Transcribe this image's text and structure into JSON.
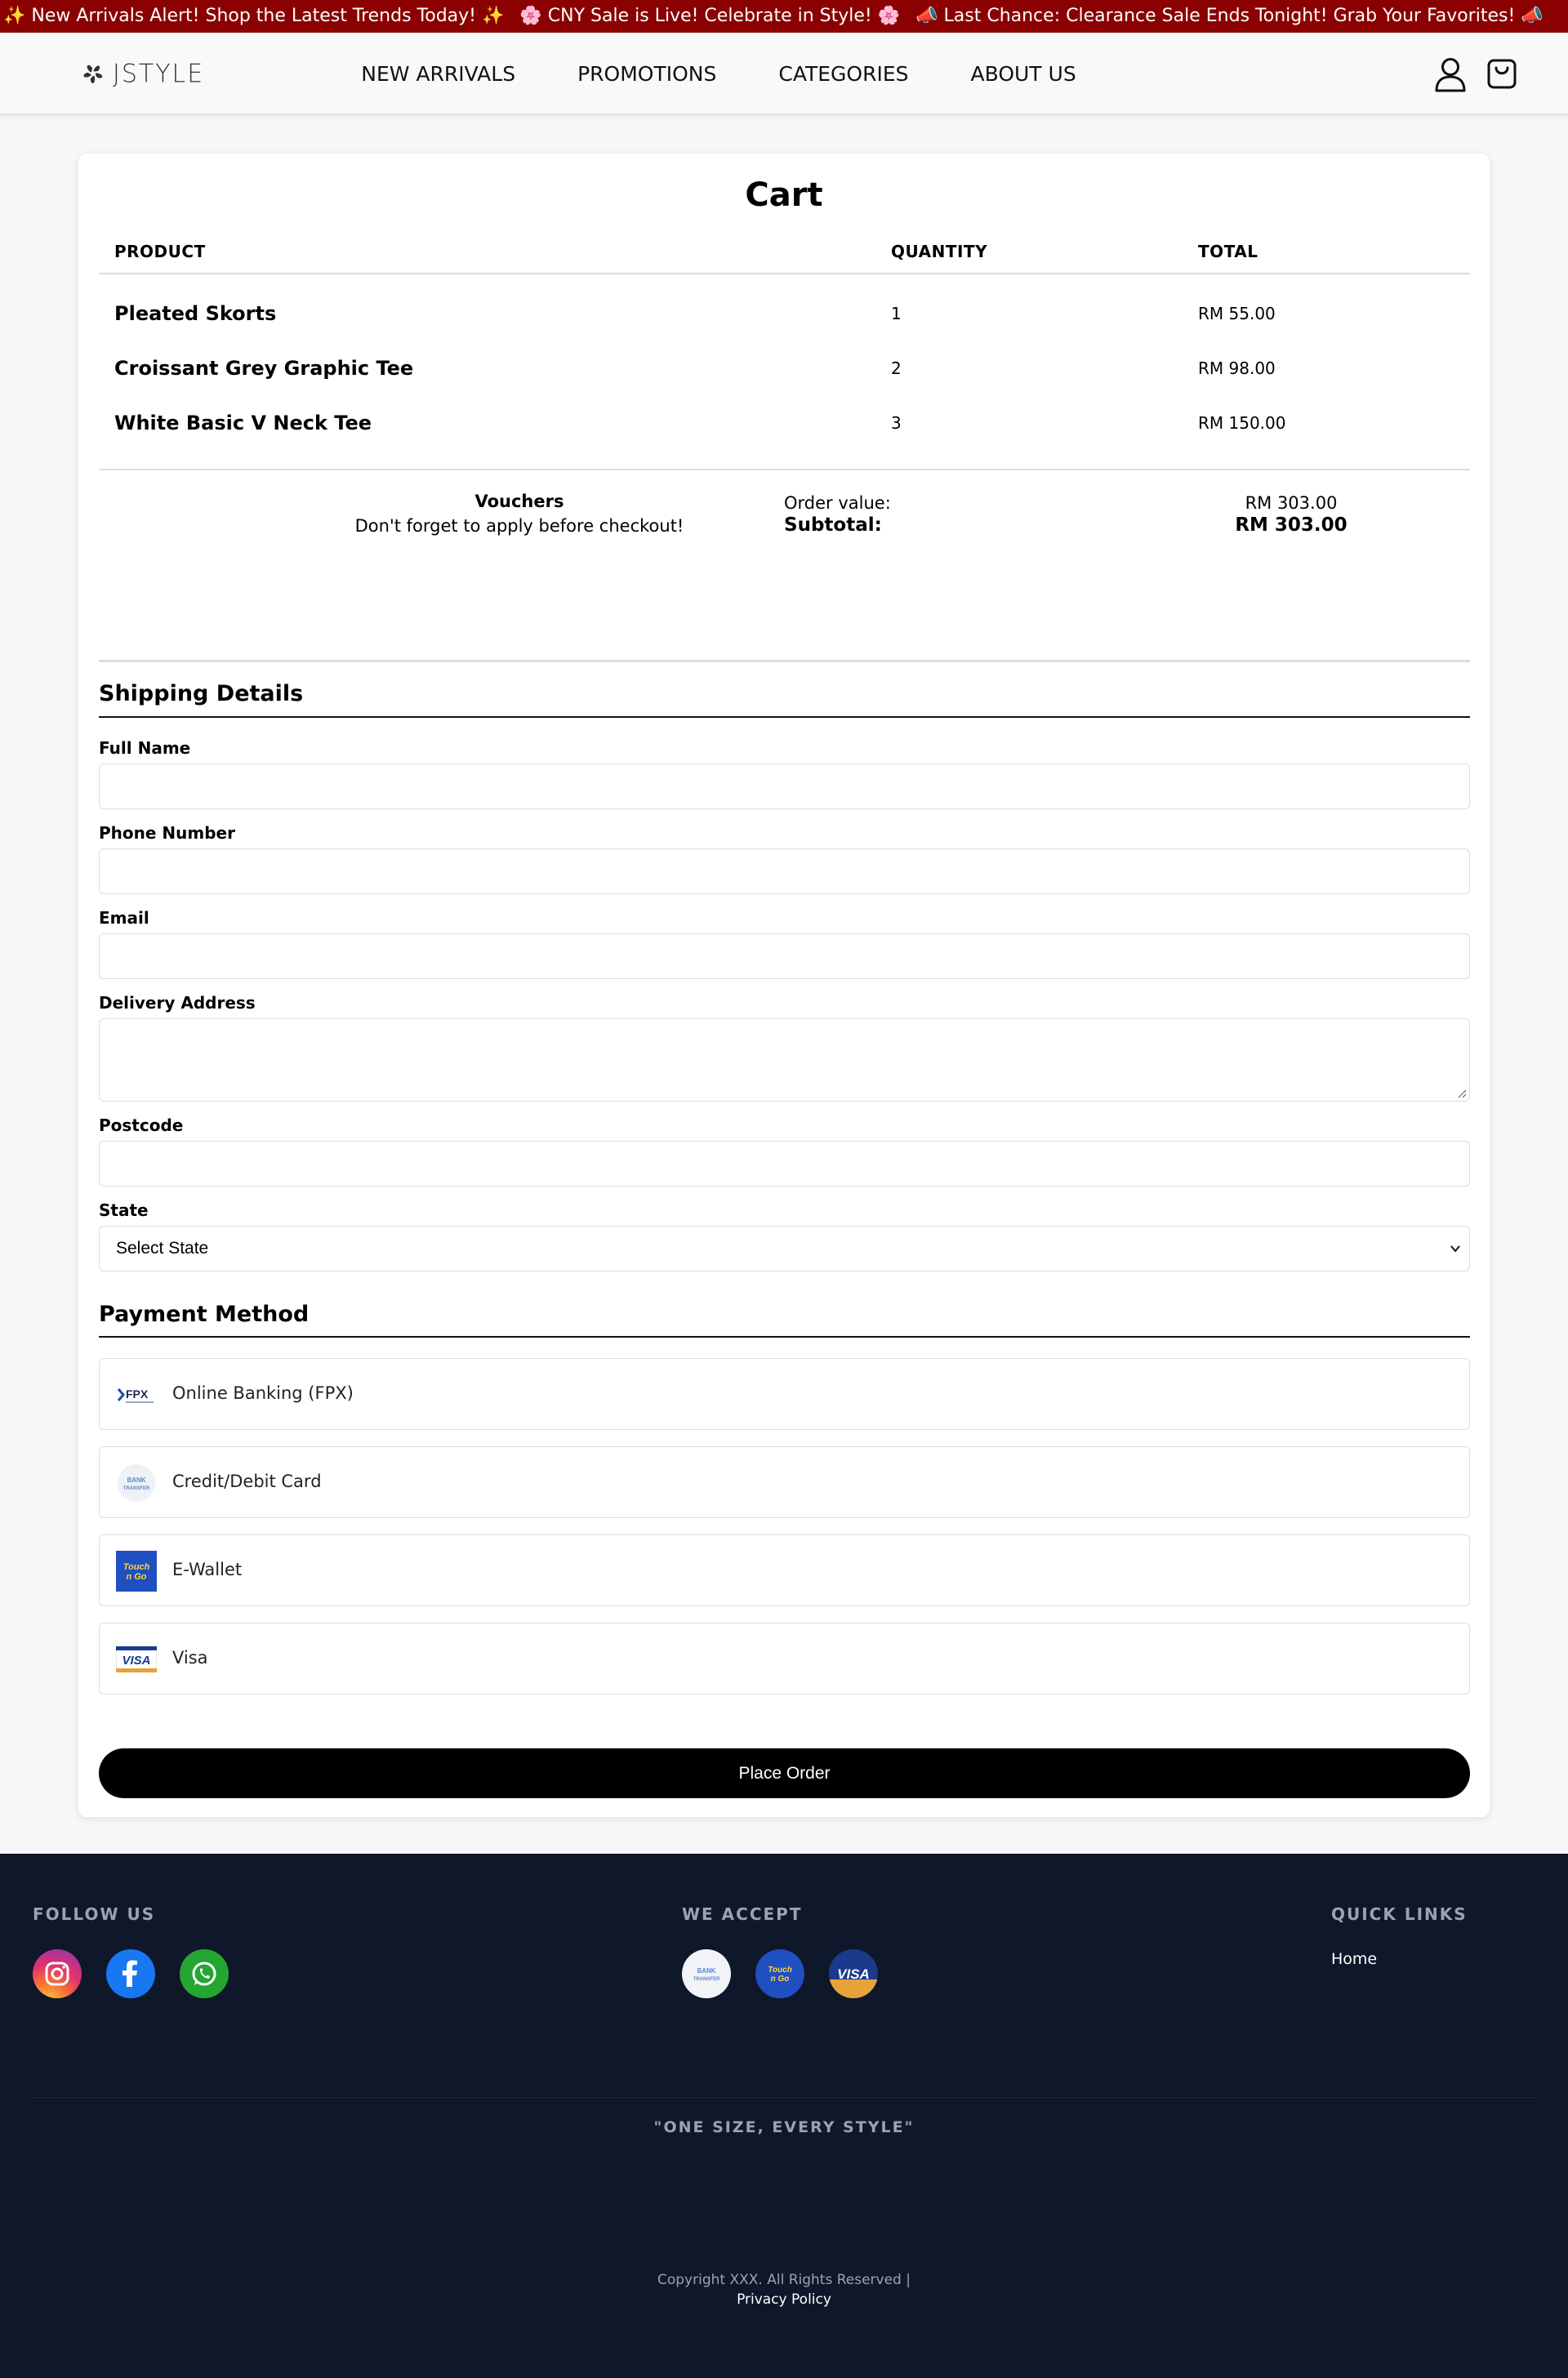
{
  "announcement": {
    "messages": [
      "✨ New Arrivals Alert! Shop the Latest Trends Today! ✨",
      "🌸 CNY Sale is Live! Celebrate in Style! 🌸",
      "📣 Last Chance: Clearance Sale Ends Tonight! Grab Your Favorites! 📣"
    ],
    "bg_color": "#8b0000"
  },
  "header": {
    "logo_text": "JSTYLE",
    "nav": [
      "NEW ARRIVALS",
      "PROMOTIONS",
      "CATEGORIES",
      "ABOUT US"
    ],
    "icons": [
      "user-icon",
      "shopping-bag-icon"
    ]
  },
  "cart": {
    "title": "Cart",
    "columns": [
      "PRODUCT",
      "QUANTITY",
      "TOTAL"
    ],
    "items": [
      {
        "name": "Pleated Skorts",
        "quantity": "1",
        "total": "RM 55.00"
      },
      {
        "name": "Croissant Grey Graphic Tee",
        "quantity": "2",
        "total": "RM 98.00"
      },
      {
        "name": "White Basic V Neck Tee",
        "quantity": "3",
        "total": "RM 150.00"
      }
    ],
    "vouchers_title": "Vouchers",
    "vouchers_note": "Don't forget to apply before checkout!",
    "order_value_label": "Order value:",
    "order_value": "RM 303.00",
    "subtotal_label": "Subtotal:",
    "subtotal": "RM 303.00"
  },
  "shipping": {
    "title": "Shipping Details",
    "full_name_label": "Full Name",
    "full_name_value": "",
    "phone_label": "Phone Number",
    "phone_value": "",
    "email_label": "Email",
    "email_value": "",
    "address_label": "Delivery Address",
    "address_value": "",
    "postcode_label": "Postcode",
    "postcode_value": "",
    "state_label": "State",
    "state_selected": "Select State"
  },
  "payment": {
    "title": "Payment Method",
    "methods": [
      {
        "label": "Online Banking (FPX)",
        "icon": "fpx-logo-icon"
      },
      {
        "label": "Credit/Debit Card",
        "icon": "bank-transfer-icon"
      },
      {
        "label": "E-Wallet",
        "icon": "touch-n-go-icon"
      },
      {
        "label": "Visa",
        "icon": "visa-icon"
      }
    ],
    "place_order": "Place Order"
  },
  "footer": {
    "follow_title": "FOLLOW US",
    "social": [
      "instagram-icon",
      "facebook-icon",
      "whatsapp-icon"
    ],
    "accept_title": "WE ACCEPT",
    "accept": [
      "bank-transfer-icon",
      "touch-n-go-icon",
      "visa-icon"
    ],
    "links_title": "QUICK LINKS",
    "links": [
      "Home"
    ],
    "slogan": "\"ONE SIZE, EVERY STYLE\"",
    "copyright": "Copyright XXX. All Rights Reserved |",
    "privacy": "Privacy Policy",
    "bg_color": "#0f172a"
  }
}
